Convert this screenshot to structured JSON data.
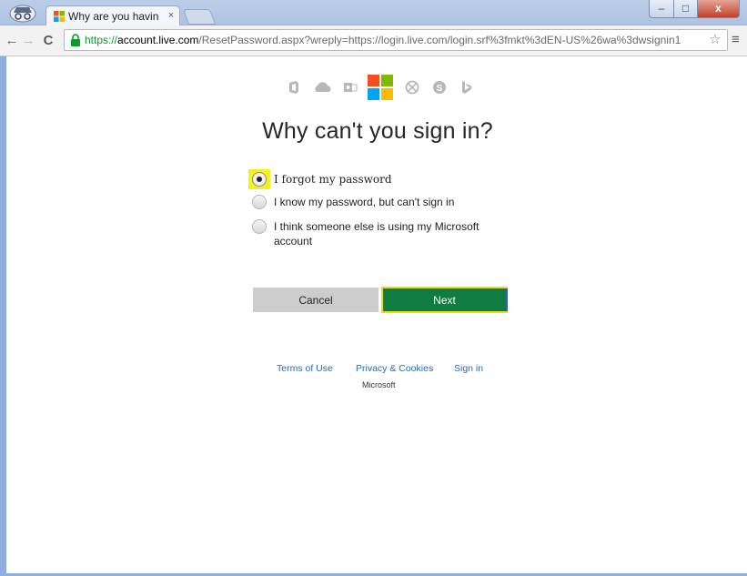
{
  "browser": {
    "tab_title": "Why are you having",
    "tab_close": "×",
    "url_scheme": "https://",
    "url_host": "account.live.com",
    "url_rest": "/ResetPassword.aspx?wreply=https://login.live.com/login.srf%3fmkt%3dEN-US%26wa%3dwsignin1",
    "star_icon": "☆",
    "menu_icon": "≡",
    "back_icon": "←",
    "forward_icon": "→",
    "reload_icon": "C",
    "window_buttons": {
      "minimize": "–",
      "maximize": "□",
      "close": "x"
    }
  },
  "page": {
    "product_icons": [
      "office-icon",
      "onedrive-icon",
      "outlook-icon",
      "microsoft-logo",
      "xbox-icon",
      "skype-icon",
      "bing-icon"
    ],
    "heading": "Why can't you sign in?",
    "options": [
      {
        "label": "I forgot my password",
        "checked": true
      },
      {
        "label": "I know my password, but can't sign in",
        "checked": false
      },
      {
        "label": "I think someone else is using my Microsoft account",
        "checked": false
      }
    ],
    "buttons": {
      "cancel": "Cancel",
      "next": "Next"
    },
    "footer": {
      "terms": "Terms of Use",
      "privacy": "Privacy & Cookies",
      "signin": "Sign in",
      "company": "Microsoft"
    }
  },
  "colors": {
    "next_button": "#107c41",
    "highlight": "#f4f11b",
    "link": "#1f6ebf",
    "microsoft_logo": [
      "#f25022",
      "#7fba00",
      "#00a4ef",
      "#ffb900"
    ]
  }
}
